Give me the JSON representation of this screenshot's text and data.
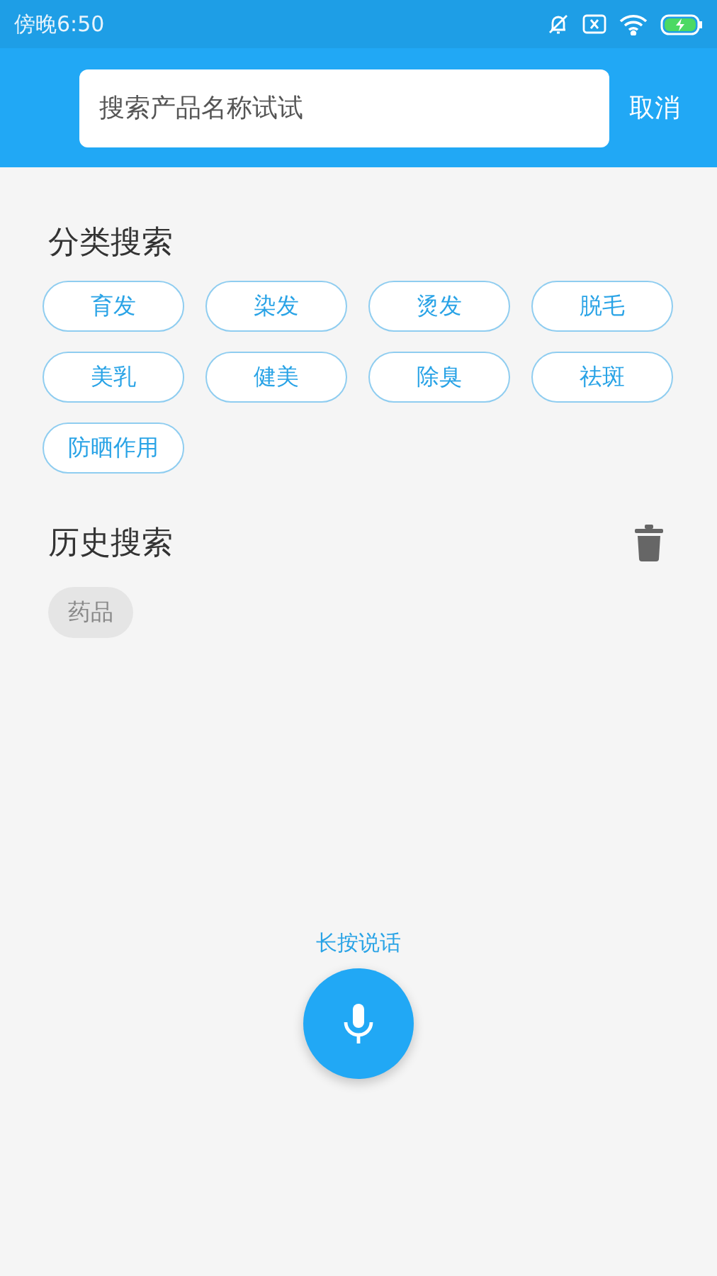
{
  "status_bar": {
    "time": "傍晚6:50"
  },
  "search": {
    "placeholder": "搜索产品名称试试",
    "cancel": "取消"
  },
  "category_section": {
    "title": "分类搜索",
    "tags": [
      "育发",
      "染发",
      "烫发",
      "脱毛",
      "美乳",
      "健美",
      "除臭",
      "祛斑",
      "防晒作用"
    ]
  },
  "history_section": {
    "title": "历史搜索",
    "items": [
      "药品"
    ]
  },
  "voice": {
    "hint": "长按说话"
  }
}
